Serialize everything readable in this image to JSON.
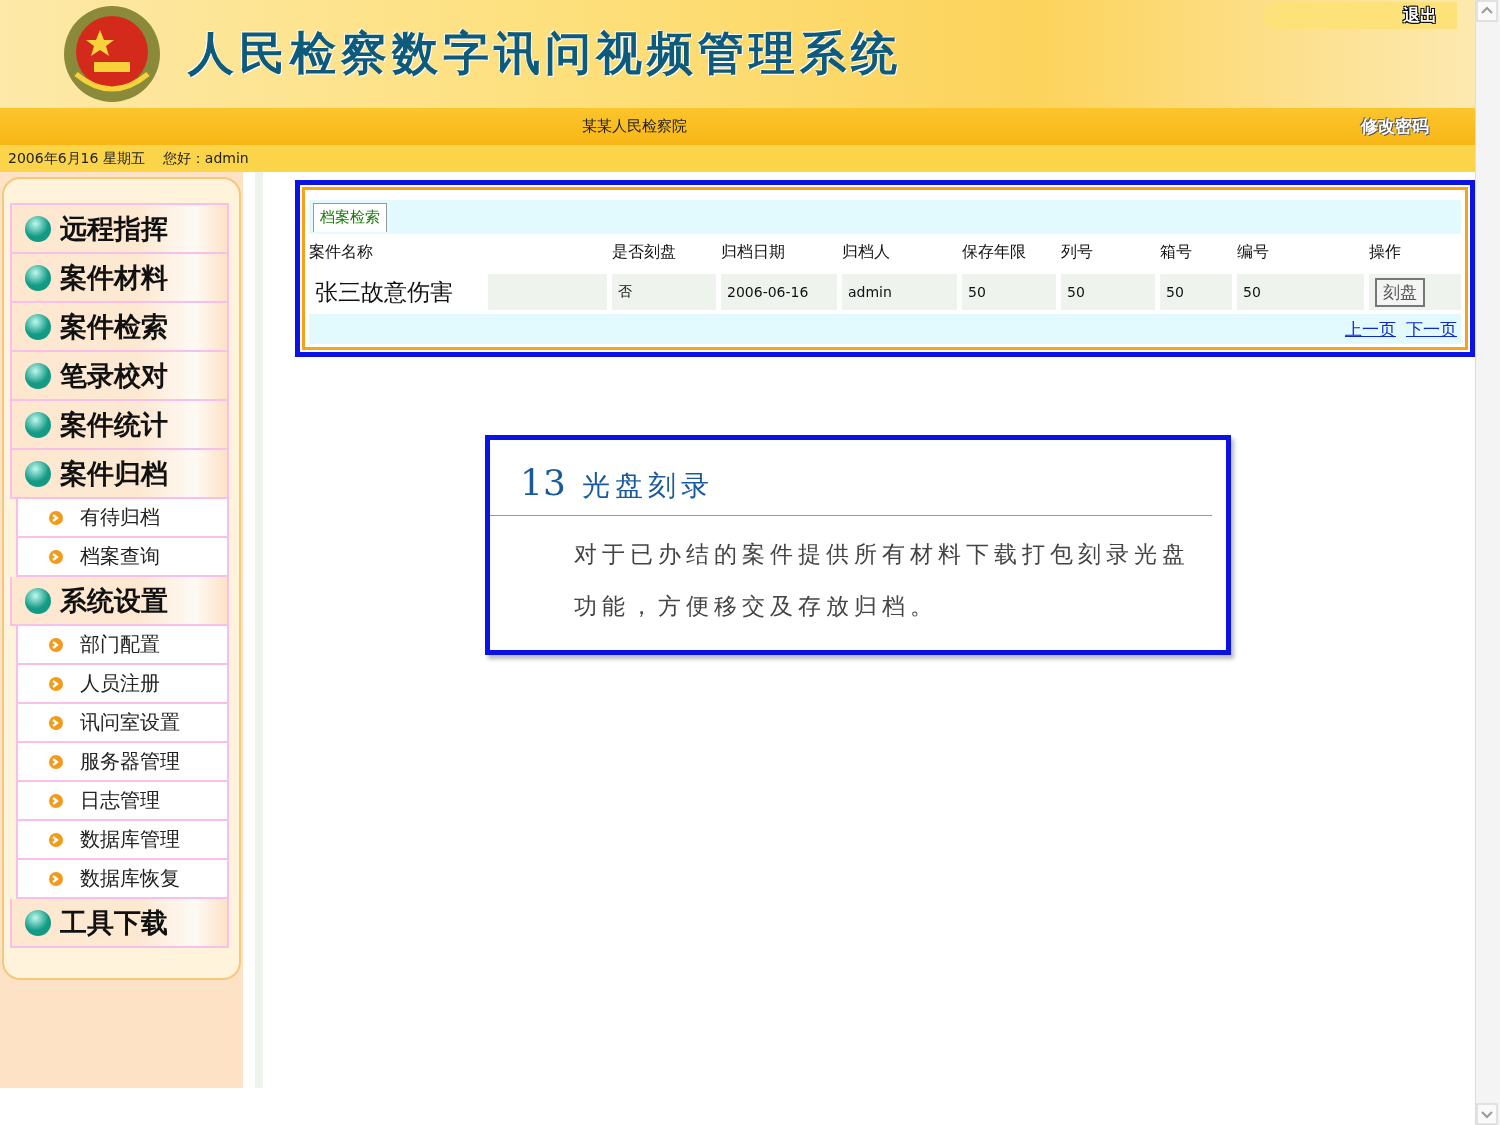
{
  "header": {
    "title": "人民检察数字讯问视频管理系统",
    "logout": "退出",
    "organization": "某某人民检察院",
    "change_password": "修改密码"
  },
  "info_bar": {
    "date": "2006年6月16 星期五",
    "greeting": "您好：admin"
  },
  "sidebar": {
    "items": [
      {
        "label": "远程指挥"
      },
      {
        "label": "案件材料"
      },
      {
        "label": "案件检索"
      },
      {
        "label": "笔录校对"
      },
      {
        "label": "案件统计"
      },
      {
        "label": "案件归档",
        "children": [
          {
            "label": "有待归档"
          },
          {
            "label": "档案查询"
          }
        ]
      },
      {
        "label": "系统设置",
        "children": [
          {
            "label": "部门配置"
          },
          {
            "label": "人员注册"
          },
          {
            "label": "讯问室设置"
          },
          {
            "label": "服务器管理"
          },
          {
            "label": "日志管理"
          },
          {
            "label": "数据库管理"
          },
          {
            "label": "数据库恢复"
          }
        ]
      },
      {
        "label": "工具下载"
      }
    ]
  },
  "panel": {
    "tabs": [
      {
        "label": "档案检索",
        "selected": true
      }
    ],
    "table": {
      "columns": [
        "案件名称",
        "是否刻盘",
        "归档日期",
        "归档人",
        "保存年限",
        "列号",
        "箱号",
        "编号",
        "操作"
      ],
      "rows": [
        {
          "cells": [
            "张三故意伤害",
            "否",
            "2006-06-16",
            "admin",
            "50",
            "50",
            "50",
            "50"
          ],
          "action": "刻盘"
        }
      ]
    },
    "pager": [
      "上一页",
      "下一页"
    ]
  },
  "callout": {
    "number": "13",
    "title": "光盘刻录",
    "text": "对于已办结的案件提供所有材料下载打包刻录光盘功能，方便移交及存放归档。"
  }
}
